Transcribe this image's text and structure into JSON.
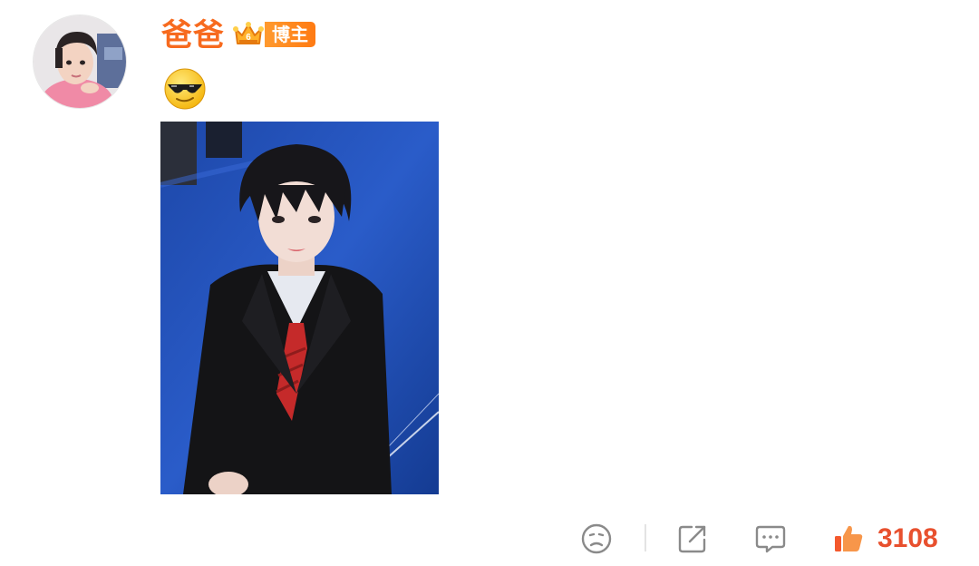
{
  "post": {
    "author_name": "爸爸",
    "badge_label": "博主",
    "content_emoji": "cool-sunglasses-emoji",
    "photo": "portrait-photo"
  },
  "actions": {
    "dislike_icon": "sad-face-icon",
    "share_icon": "share-icon",
    "comment_icon": "comment-icon",
    "like_icon": "thumbs-up-icon",
    "like_count": "3108"
  },
  "colors": {
    "username": "#f76a1e",
    "badge": "#ff8a1e",
    "like_count": "#e8502e",
    "icon_gray": "#8a8a8a"
  }
}
